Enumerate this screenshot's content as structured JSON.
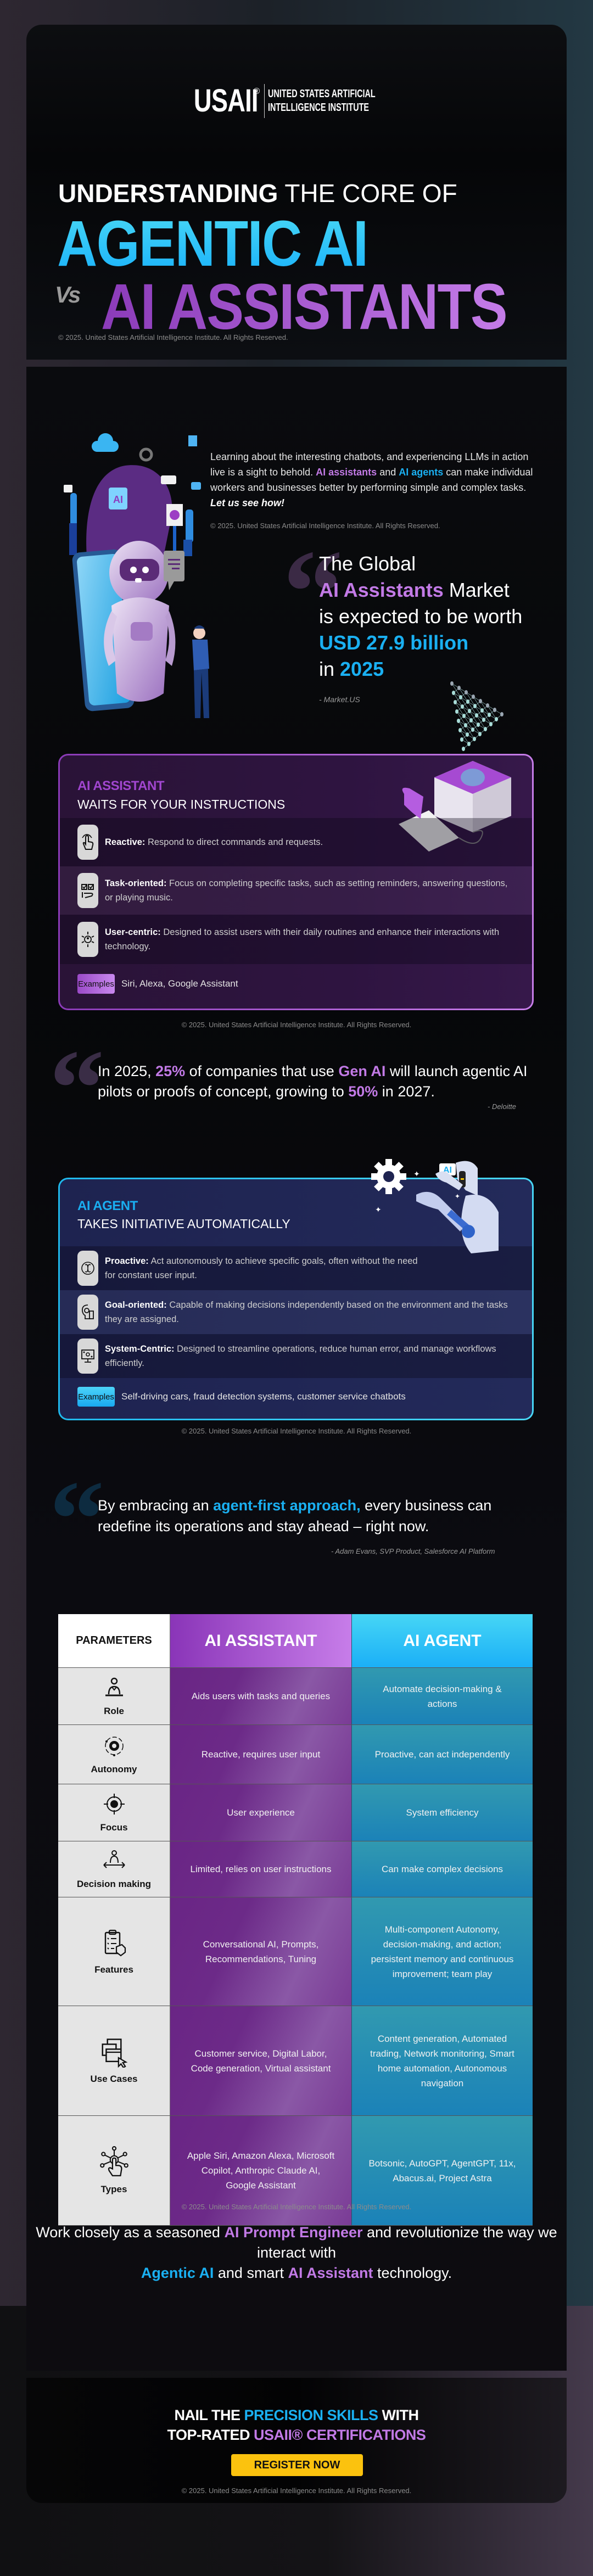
{
  "header": {
    "logo_mark": "USAII",
    "logo_reg": "®",
    "logo_text_line1": "UNITED STATES ARTIFICIAL",
    "logo_text_line2": "INTELLIGENCE INSTITUTE",
    "title_bold": "UNDERSTANDING",
    "title_rest": " THE CORE OF",
    "title_agentic": "AGENTIC AI",
    "title_vs": "Vs",
    "title_assistants": "AI ASSISTANTS",
    "copyright": "© 2025. United States Artificial Intelligence Institute. All Rights Reserved."
  },
  "intro": {
    "text_part1": "Learning about the interesting chatbots, and experiencing LLMs in action live is a sight to behold. ",
    "hl_assistants": "AI assistants",
    "text_and": " and ",
    "hl_agents": "AI agents",
    "text_part2": " can make individual workers and businesses better by performing simple and complex tasks. ",
    "cta_italic": "Let us see how!",
    "copyright": "© 2025. United States Artificial Intelligence Institute. All Rights Reserved."
  },
  "market_quote": {
    "line1": "The Global",
    "hl_assistants": "AI Assistants",
    "line2_rest": " Market",
    "line3": "is expected to be worth",
    "value": "USD 27.9 billion",
    "line5_prefix": "in ",
    "year": "2025",
    "source": "- Market.US"
  },
  "ai_assistant_box": {
    "kicker": "AI ASSISTANT",
    "subtitle": "WAITS FOR YOUR INSTRUCTIONS",
    "features": [
      {
        "icon": "tap-hand-icon",
        "title": "Reactive:",
        "desc": " Respond to direct commands and requests."
      },
      {
        "icon": "task-checklist-icon",
        "title": "Task-oriented:",
        "desc": " Focus on completing specific tasks, such as setting reminders, answering questions, or playing music."
      },
      {
        "icon": "user-centric-icon",
        "title": "User-centric:",
        "desc": " Designed to assist users with their daily routines and enhance their interactions with technology."
      }
    ],
    "examples_label": "Examples",
    "examples": "Siri, Alexa, Google Assistant",
    "copyright": "© 2025. United States Artificial Intelligence Institute. All Rights Reserved."
  },
  "deloitte_quote": {
    "p1": "In 2025, ",
    "v1": "25%",
    "p2": " of companies that use ",
    "v2": "Gen AI",
    "p3": " will launch agentic AI pilots or proofs of concept, growing to ",
    "v3": "50%",
    "p4": " in 2027.",
    "source": "- Deloitte"
  },
  "ai_agent_box": {
    "illus_badge": "AI",
    "kicker": "AI AGENT",
    "subtitle": "TAKES INITIATIVE AUTOMATICALLY",
    "features": [
      {
        "icon": "brain-cycle-icon",
        "title": "Proactive:",
        "desc": " Act autonomously to achieve specific goals, often without the need for constant user input."
      },
      {
        "icon": "goal-chess-icon",
        "title": "Goal-oriented:",
        "desc": " Capable of making decisions independently based on the environment and the tasks they are assigned."
      },
      {
        "icon": "system-monitor-icon",
        "title": "System-Centric:",
        "desc": " Designed to streamline operations, reduce human error, and manage workflows efficiently."
      }
    ],
    "examples_label": "Examples",
    "examples": "Self-driving cars, fraud detection systems, customer service chatbots",
    "copyright": "© 2025. United States Artificial Intelligence Institute. All Rights Reserved."
  },
  "salesforce_quote": {
    "p1": "By embracing an ",
    "hl": "agent-first approach,",
    "p2": " every business can redefine its operations and stay ahead – right now.",
    "source": "- Adam Evans, SVP Product, Salesforce AI Platform"
  },
  "comparison": {
    "headers": [
      "PARAMETERS",
      "AI ASSISTANT",
      "AI AGENT"
    ],
    "rows": [
      {
        "param": "Role",
        "icon": "role-person-icon",
        "assistant": "Aids users with tasks and queries",
        "agent": "Automate decision-making & actions"
      },
      {
        "param": "Autonomy",
        "icon": "autonomy-gear-icon",
        "assistant": "Reactive, requires user input",
        "agent": "Proactive, can act independently"
      },
      {
        "param": "Focus",
        "icon": "focus-target-icon",
        "assistant": "User experience",
        "agent": "System efficiency"
      },
      {
        "param": "Decision making",
        "icon": "decision-arrows-icon",
        "assistant": "Limited, relies on user instructions",
        "agent": "Can make complex decisions"
      },
      {
        "param": "Features",
        "icon": "features-clipboard-icon",
        "assistant": "Conversational AI, Prompts, Recommendations, Tuning",
        "agent": "Multi-component Autonomy, decision-making, and action; persistent memory and continuous improvement; team play"
      },
      {
        "param": "Use Cases",
        "icon": "use-cases-windows-icon",
        "assistant": "Customer service, Digital Labor, Code generation, Virtual assistant",
        "agent": "Content generation, Automated trading, Network monitoring, Smart home automation, Autonomous navigation"
      },
      {
        "param": "Types",
        "icon": "types-network-hand-icon",
        "assistant": "Apple Siri, Amazon Alexa, Microsoft Copilot, Anthropic Claude AI, Google Assistant",
        "agent": "Botsonic, AutoGPT, AgentGPT, 11x, Abacus.ai, Project Astra"
      }
    ],
    "copyright": "© 2025. United States Artificial Intelligence Institute. All Rights Reserved."
  },
  "closing": {
    "p1": "Work closely as a seasoned ",
    "hl1": "AI Prompt Engineer",
    "p2": " and revolutionize the way we interact with ",
    "hl2": "Agentic AI",
    "p3": " and smart ",
    "hl3": "AI Assistant",
    "p4": " technology."
  },
  "cta": {
    "nail_p1": "NAIL THE ",
    "nail_hl": "PRECISION SKILLS",
    "nail_p2": " WITH",
    "top_rated": "TOP-RATED ",
    "cert_hl": "USAII® CERTIFICATIONS",
    "button": "REGISTER NOW",
    "copyright": "© 2025. United States Artificial Intelligence Institute. All Rights Reserved."
  },
  "colors": {
    "accent_blue": "#1ab2fb",
    "accent_purple": "#c27ae6",
    "cta_yellow": "#fbc20e"
  }
}
